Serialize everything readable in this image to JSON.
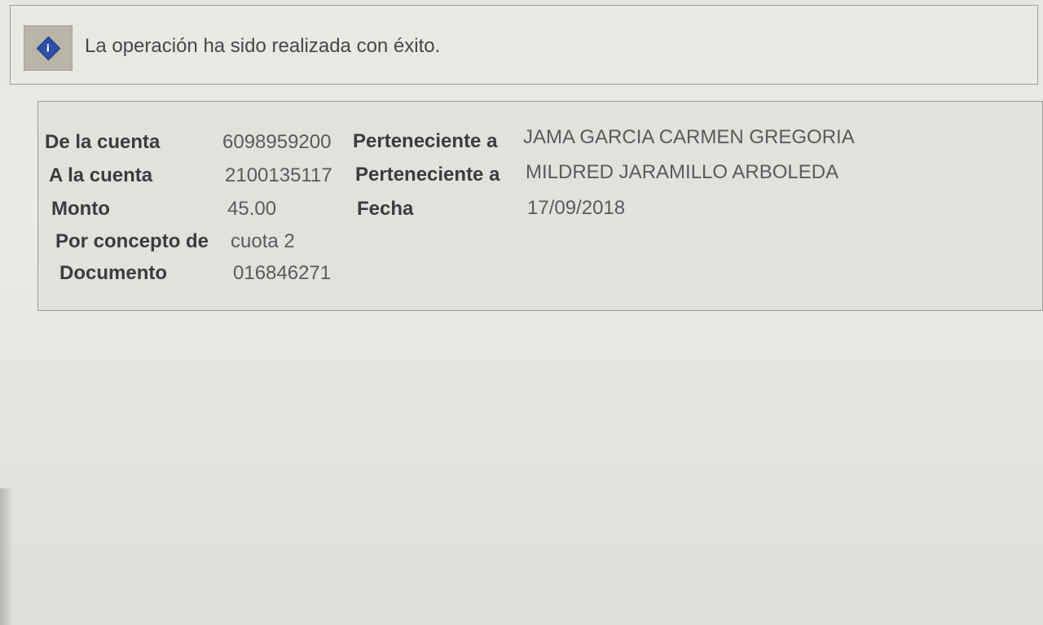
{
  "message": {
    "icon": "info-icon",
    "text": "La operación ha sido realizada con éxito."
  },
  "details": {
    "from_account": {
      "label": "De la cuenta",
      "number": "6098959200",
      "owner_label": "Perteneciente a",
      "owner_name": "JAMA GARCIA CARMEN GREGORIA"
    },
    "to_account": {
      "label": "A la cuenta",
      "number": "2100135117",
      "owner_label": "Perteneciente a",
      "owner_name": "MILDRED JARAMILLO ARBOLEDA"
    },
    "amount": {
      "label": "Monto",
      "value": "45.00"
    },
    "date": {
      "label": "Fecha",
      "value": "17/09/2018"
    },
    "concept": {
      "label": "Por concepto de",
      "value": "cuota 2"
    },
    "document": {
      "label": "Documento",
      "value": "016846271"
    }
  }
}
